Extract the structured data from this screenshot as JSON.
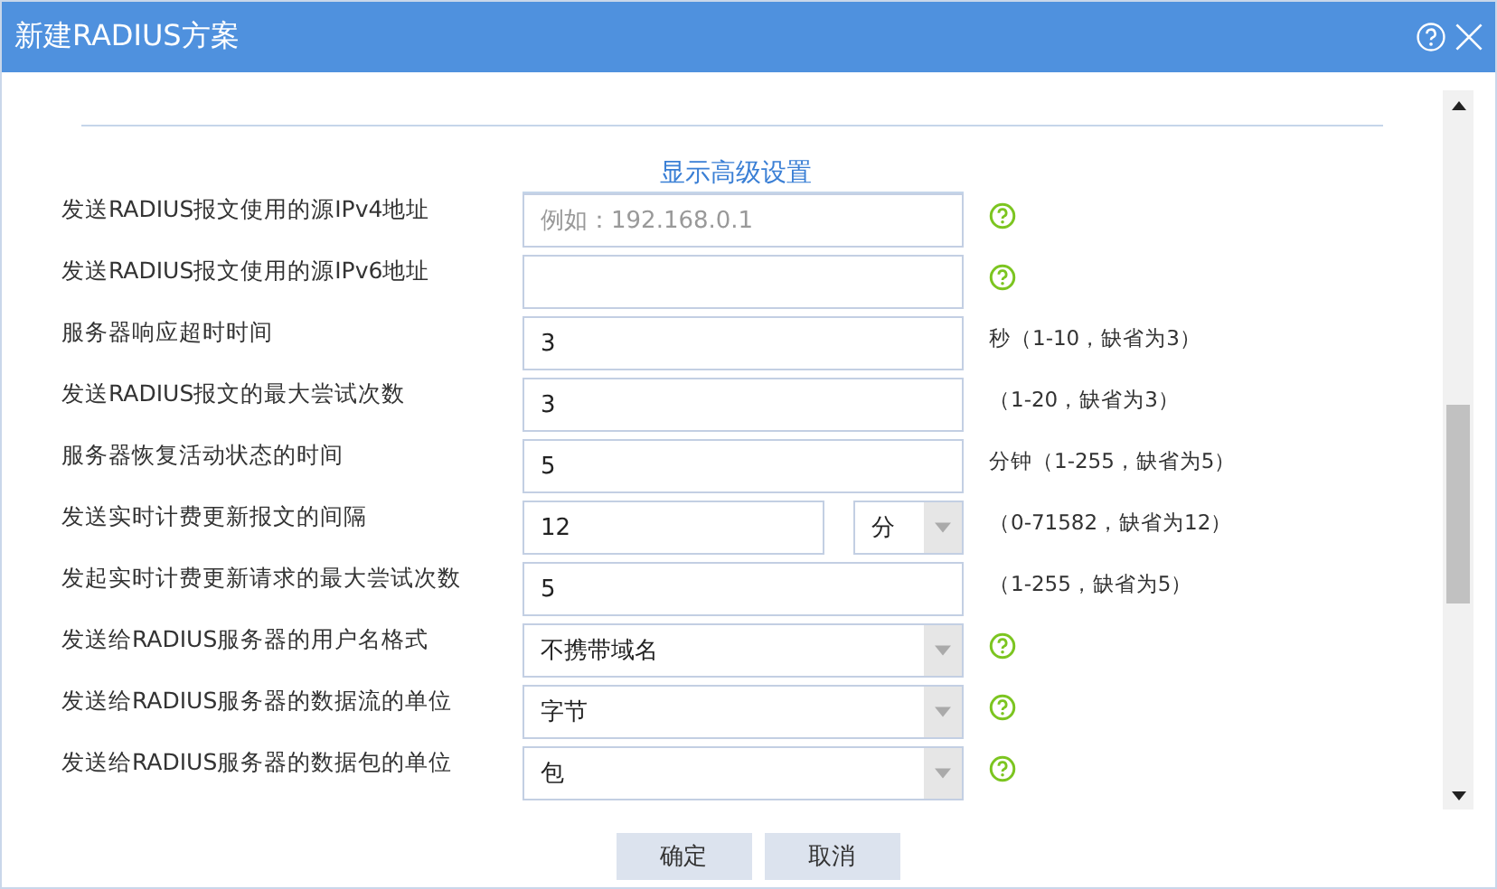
{
  "window": {
    "title": "新建RADIUS方案"
  },
  "advanced_link": "显示高级设置",
  "rows": [
    {
      "label": "发送RADIUS报文使用的源IPv4地址",
      "kind": "input",
      "placeholder": "例如：192.168.0.1",
      "help": true
    },
    {
      "label": "发送RADIUS报文使用的源IPv6地址",
      "kind": "input",
      "help": true
    },
    {
      "label": "服务器响应超时时间",
      "kind": "input",
      "value": "3",
      "hint": "秒（1-10，缺省为3）"
    },
    {
      "label": "发送RADIUS报文的最大尝试次数",
      "kind": "input",
      "value": "3",
      "hint": "（1-20，缺省为3）"
    },
    {
      "label": "服务器恢复活动状态的时间",
      "kind": "input",
      "value": "5",
      "hint": "分钟（1-255，缺省为5）"
    },
    {
      "label": "发送实时计费更新报文的间隔",
      "kind": "input-unit",
      "value": "12",
      "unit": "分",
      "hint": "（0-71582，缺省为12）"
    },
    {
      "label": "发起实时计费更新请求的最大尝试次数",
      "kind": "input",
      "value": "5",
      "hint": "（1-255，缺省为5）"
    },
    {
      "label": "发送给RADIUS服务器的用户名格式",
      "kind": "select",
      "value": "不携带域名",
      "help": true
    },
    {
      "label": "发送给RADIUS服务器的数据流的单位",
      "kind": "select",
      "value": "字节",
      "help": true
    },
    {
      "label": "发送给RADIUS服务器的数据包的单位",
      "kind": "select",
      "value": "包",
      "help": true
    }
  ],
  "buttons": [
    "确定",
    "取消"
  ]
}
